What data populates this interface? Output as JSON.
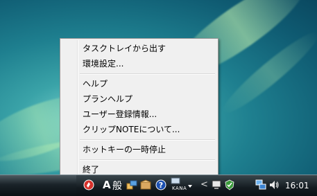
{
  "context_menu": {
    "items": [
      {
        "label": "タスクトレイから出す"
      },
      {
        "label": "環境設定..."
      },
      {
        "label": "ヘルプ"
      },
      {
        "label": "プランヘルプ"
      },
      {
        "label": "ユーザー登録情報..."
      },
      {
        "label": "クリップNOTEについて..."
      },
      {
        "label": "ホットキーの一時停止"
      },
      {
        "label": "終了"
      }
    ]
  },
  "taskbar": {
    "language_indicator": "A",
    "ime_mode": "般",
    "ime_kana": "KANA",
    "show_hidden": "<",
    "clock": "16:01"
  },
  "tray_icons": [
    "clipnote-icon",
    "ime-tools-icon",
    "package-icon",
    "help-icon",
    "tray-arrow-icon",
    "network-shield-icon",
    "security-check-icon",
    "network-icon",
    "volume-icon"
  ],
  "colors": {
    "menu_bg": "#f0f0f0",
    "taskbar": "#1a2329",
    "clipnote_red": "#d6312b"
  }
}
